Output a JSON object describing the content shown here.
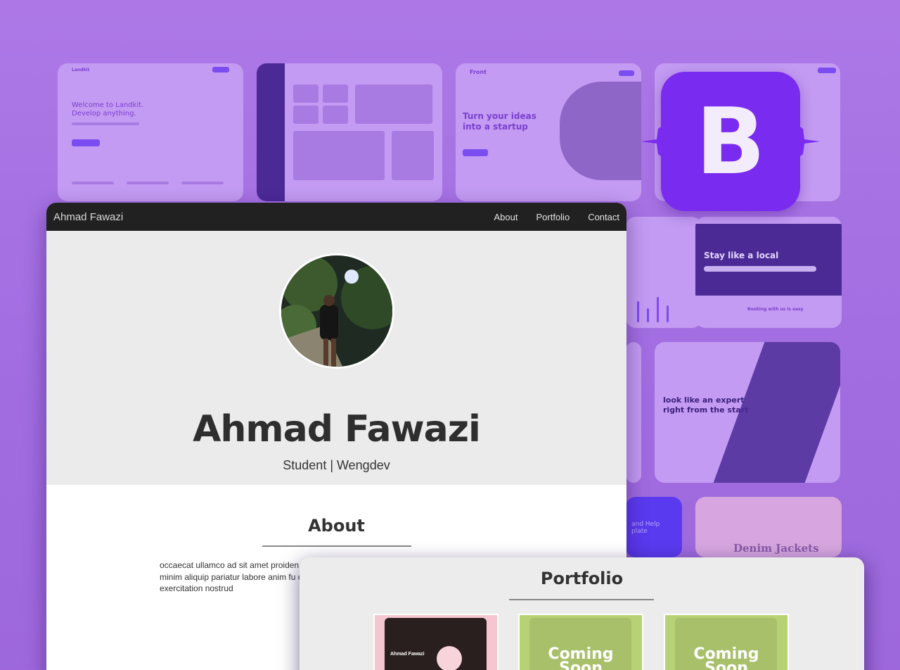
{
  "background": {
    "card_landkit": {
      "logo": "Landkit",
      "headline_1": "Welcome to Landkit.",
      "headline_2": "Develop anything."
    },
    "card_front": {
      "logo": "Front",
      "headline": "Turn your ideas into a startup"
    },
    "card_stay": {
      "headline": "Stay like a local",
      "caption": "Booking with us is easy"
    },
    "card_expert": {
      "headline_1": "look like an expert",
      "headline_2": "right from the start"
    },
    "card_denim": {
      "headline": "Denim Jackets"
    },
    "card_blue": {
      "text": "and Help plate"
    }
  },
  "bootstrap_logo": {
    "letter": "B"
  },
  "site": {
    "brand": "Ahmad Fawazi",
    "nav": [
      "About",
      "Portfolio",
      "Contact"
    ],
    "hero": {
      "name": "Ahmad Fawazi",
      "subtitle": "Student | Wengdev"
    },
    "about": {
      "title": "About",
      "text": "occaecat ullamco ad sit amet proiden adipisicing magna ullamco exercitati minim aliquip pariatur labore anim fu commodo do nulla veniam consectet exercitation nostrud"
    }
  },
  "portfolio": {
    "title": "Portfolio",
    "items": [
      {
        "title": "Ahmad Fawazi"
      },
      {
        "label_1": "Coming",
        "label_2": "Soon"
      },
      {
        "label_1": "Coming",
        "label_2": "Soon"
      }
    ]
  },
  "colors": {
    "accent": "#7a2bf0",
    "navbar": "#212121",
    "hero_bg": "#ebebeb",
    "page_bg": "#a56fe2"
  }
}
